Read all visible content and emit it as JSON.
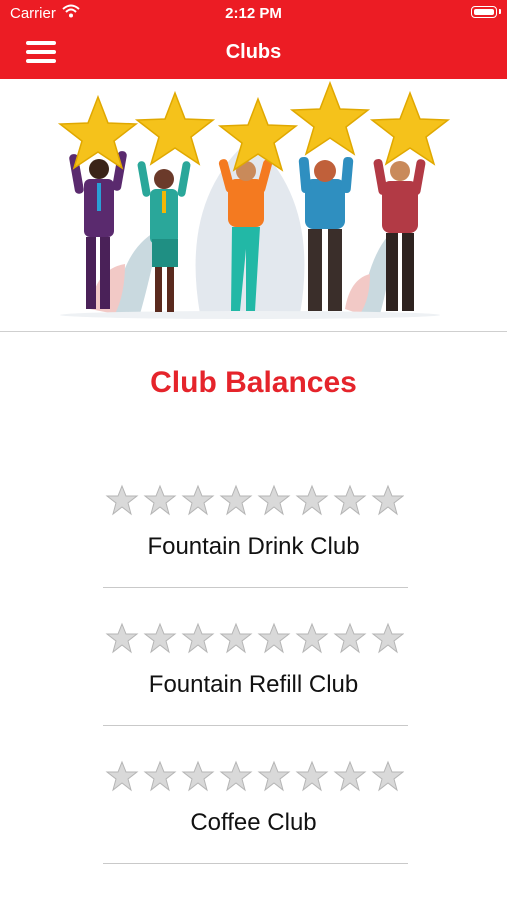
{
  "status": {
    "carrier": "Carrier",
    "time": "2:12 PM"
  },
  "nav": {
    "title": "Clubs"
  },
  "section_title": "Club Balances",
  "clubs": [
    {
      "name": "Fountain Drink Club",
      "stars_total": 8,
      "stars_filled": 0
    },
    {
      "name": "Fountain Refill Club",
      "stars_total": 8,
      "stars_filled": 0
    },
    {
      "name": "Coffee Club",
      "stars_total": 8,
      "stars_filled": 0
    }
  ],
  "colors": {
    "brand": "#ec1c24",
    "title": "#e5242b",
    "star_empty": "#d9d9d9"
  }
}
